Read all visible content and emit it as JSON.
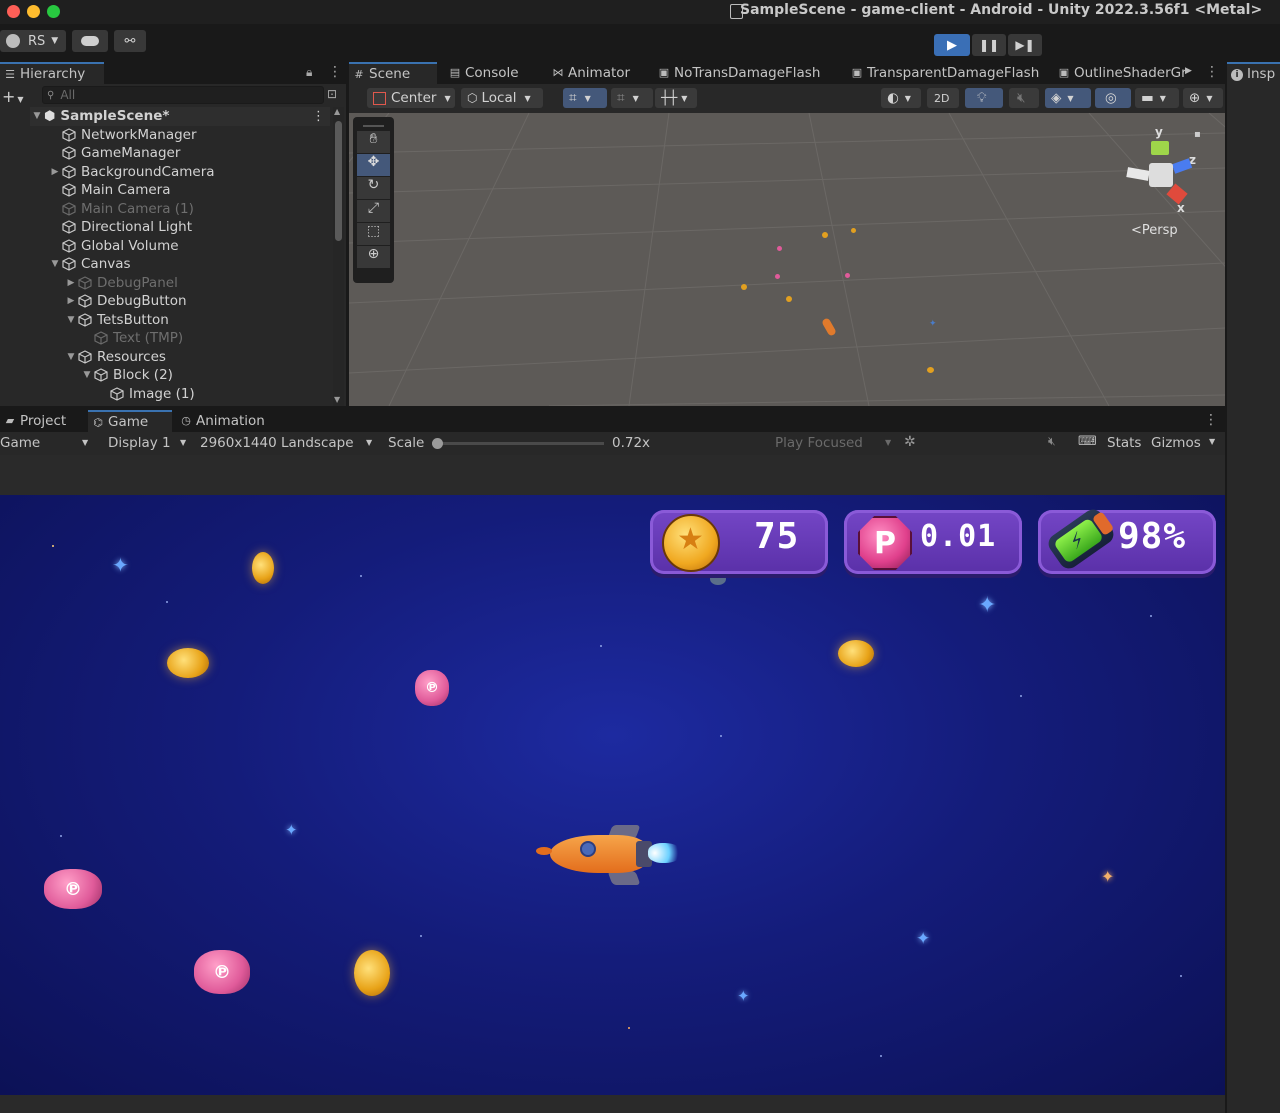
{
  "window": {
    "title": "SampleScene - game-client - Android - Unity 2022.3.56f1 <Metal>"
  },
  "toolbar": {
    "account": "RS"
  },
  "hierarchy": {
    "tab": "Hierarchy",
    "search_placeholder": "All",
    "items": [
      {
        "label": "SampleScene*"
      },
      {
        "label": "NetworkManager"
      },
      {
        "label": "GameManager"
      },
      {
        "label": "BackgroundCamera"
      },
      {
        "label": "Main Camera"
      },
      {
        "label": "Main Camera (1)"
      },
      {
        "label": "Directional Light"
      },
      {
        "label": "Global Volume"
      },
      {
        "label": "Canvas"
      },
      {
        "label": "DebugPanel"
      },
      {
        "label": "DebugButton"
      },
      {
        "label": "TetsButton"
      },
      {
        "label": "Text (TMP)"
      },
      {
        "label": "Resources"
      },
      {
        "label": "Block (2)"
      },
      {
        "label": "Image (1)"
      }
    ]
  },
  "scene_tabs": [
    "Scene",
    "Console",
    "Animator",
    "NoTransDamageFlash",
    "TransparentDamageFlash",
    "OutlineShaderGr"
  ],
  "inspector_tab": "Insp",
  "scene_toolbar": {
    "pivot": "Center",
    "space": "Local",
    "mode_2d": "2D",
    "projection": "Persp"
  },
  "gizmo_axes": {
    "y": "y",
    "z": "z",
    "x": "x"
  },
  "bottom_tabs": [
    "Project",
    "Game",
    "Animation"
  ],
  "game_toolbar": {
    "view": "Game",
    "display": "Display 1",
    "resolution": "2960x1440 Landscape",
    "scale_label": "Scale",
    "scale_value": "0.72x",
    "play_mode": "Play Focused",
    "stats": "Stats",
    "gizmos": "Gizmos"
  },
  "hud": {
    "coins": "75",
    "tokens": "0.01",
    "fuel": "98%"
  },
  "colors": {
    "accent": "#3a72b0",
    "hud_purple": "#6a3cb8",
    "space_bg": "#141c7a"
  }
}
